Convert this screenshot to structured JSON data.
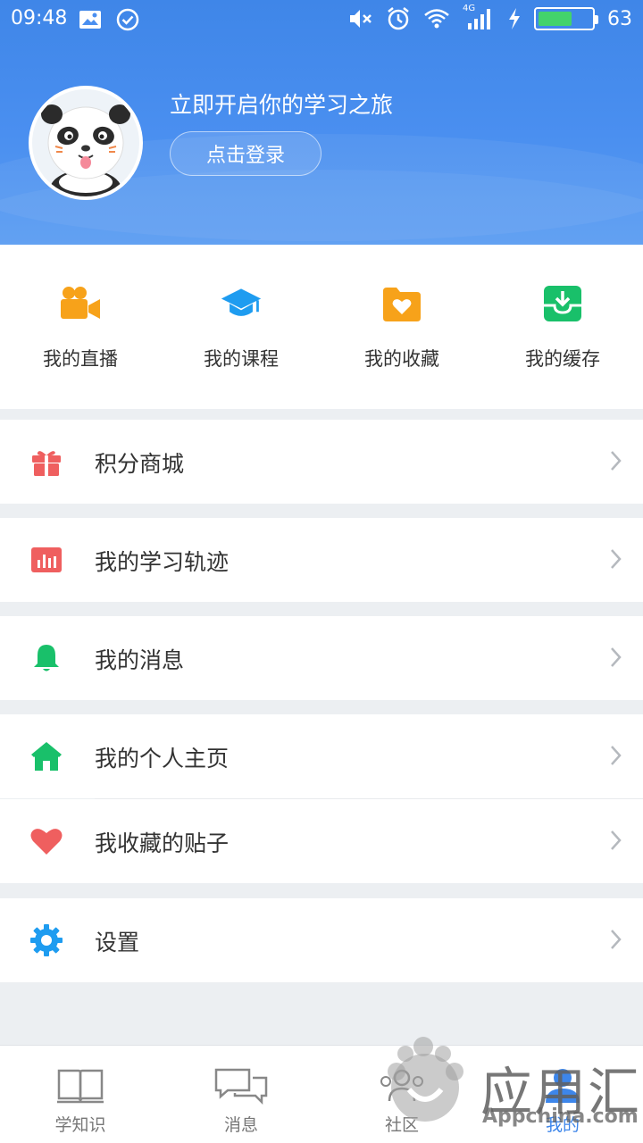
{
  "status_bar": {
    "time": "09:48",
    "network": "4G",
    "battery": "63",
    "battery_level": 0.63
  },
  "header": {
    "slogan": "立即开启你的学习之旅",
    "login_label": "点击登录"
  },
  "quick_actions": [
    {
      "label": "我的直播",
      "icon": "video-camera-icon",
      "color": "#f7a21a"
    },
    {
      "label": "我的课程",
      "icon": "graduation-cap-icon",
      "color": "#1e9cf0"
    },
    {
      "label": "我的收藏",
      "icon": "heart-folder-icon",
      "color": "#f7a21a"
    },
    {
      "label": "我的缓存",
      "icon": "download-box-icon",
      "color": "#19c06a"
    }
  ],
  "menu": [
    {
      "label": "积分商城",
      "icon": "gift-icon",
      "color": "#ef5f5f"
    },
    {
      "label": "我的学习轨迹",
      "icon": "bar-chart-icon",
      "color": "#ef5f5f"
    },
    {
      "label": "我的消息",
      "icon": "bell-icon",
      "color": "#19c06a"
    },
    {
      "label": "我的个人主页",
      "icon": "home-icon",
      "color": "#19c06a"
    },
    {
      "label": "我收藏的贴子",
      "icon": "heart-icon",
      "color": "#ef5f5f"
    },
    {
      "label": "设置",
      "icon": "gear-icon",
      "color": "#1e9cf0"
    }
  ],
  "bottom_nav": [
    {
      "label": "学知识",
      "icon": "book-icon"
    },
    {
      "label": "消息",
      "icon": "chat-icon"
    },
    {
      "label": "社区",
      "icon": "community-icon"
    },
    {
      "label": "我的",
      "icon": "person-icon",
      "active": true
    }
  ],
  "watermark": {
    "text": "应用汇",
    "sub": "Appchina.com"
  }
}
